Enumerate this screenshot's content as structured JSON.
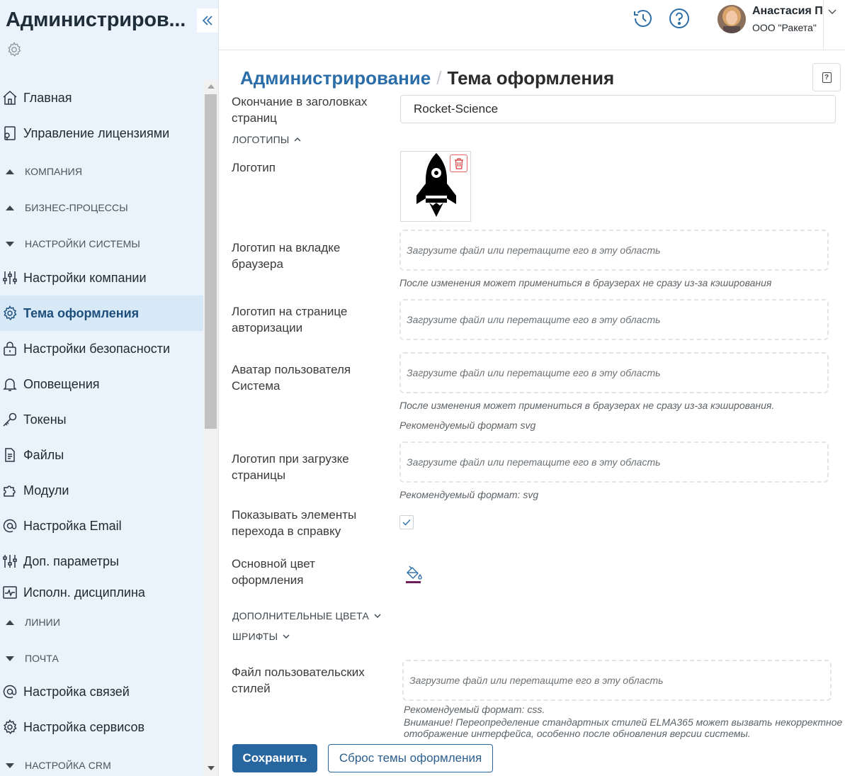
{
  "app": {
    "title": "Администриров...",
    "collapse_icon": "double-chevron-left-icon",
    "settings_icon": "gear-icon"
  },
  "sidebar": {
    "items": [
      {
        "type": "item",
        "label": "Главная",
        "icon": "home-icon"
      },
      {
        "type": "item",
        "label": "Управление лицензиями",
        "icon": "license-icon"
      },
      {
        "type": "section",
        "label": "КОМПАНИЯ",
        "state": "collapsed"
      },
      {
        "type": "section",
        "label": "БИЗНЕС-ПРОЦЕССЫ",
        "state": "collapsed"
      },
      {
        "type": "section",
        "label": "НАСТРОЙКИ СИСТЕМЫ",
        "state": "expanded"
      },
      {
        "type": "item",
        "label": "Настройки компании",
        "icon": "sliders-icon"
      },
      {
        "type": "item",
        "label": "Тема оформления",
        "icon": "gear-icon",
        "active": true
      },
      {
        "type": "item",
        "label": "Настройки безопасности",
        "icon": "lock-icon"
      },
      {
        "type": "item",
        "label": "Оповещения",
        "icon": "bell-icon"
      },
      {
        "type": "item",
        "label": "Токены",
        "icon": "key-icon"
      },
      {
        "type": "item",
        "label": "Файлы",
        "icon": "file-icon"
      },
      {
        "type": "item",
        "label": "Модули",
        "icon": "puzzle-icon"
      },
      {
        "type": "item",
        "label": "Настройка Email",
        "icon": "at-icon"
      },
      {
        "type": "item",
        "label": "Доп. параметры",
        "icon": "sliders-icon"
      },
      {
        "type": "item",
        "label": "Исполн. дисциплина",
        "icon": "pulse-icon"
      },
      {
        "type": "section",
        "label": "ЛИНИИ",
        "state": "collapsed"
      },
      {
        "type": "section",
        "label": "ПОЧТА",
        "state": "expanded"
      },
      {
        "type": "item",
        "label": "Настройка связей",
        "icon": "at-icon"
      },
      {
        "type": "item",
        "label": "Настройка сервисов",
        "icon": "gear-icon"
      },
      {
        "type": "section",
        "label": "НАСТРОЙКА CRM",
        "state": "expanded"
      }
    ]
  },
  "header": {
    "history_icon": "history-icon",
    "help_icon": "help-circle-icon",
    "user": {
      "name": "Анастасия П",
      "org": "ООО \"Ракета\"",
      "chevron_icon": "chevron-down-icon"
    }
  },
  "breadcrumb": {
    "root": "Администрирование",
    "separator": "/",
    "current": "Тема оформления"
  },
  "page_help": "?",
  "form": {
    "title_suffix": {
      "label": "Окончание в заголовках страниц",
      "value": "Rocket-Science"
    },
    "logos_section": "ЛОГОТИПЫ",
    "logo": {
      "label": "Логотип",
      "delete_icon": "trash-icon",
      "image_icon": "rocket-icon"
    },
    "favicon": {
      "label": "Логотип на вкладке браузера",
      "placeholder": "Загрузите файл или перетащите его в эту область",
      "hint": "После изменения может примениться в браузерах не сразу из-за кэширования"
    },
    "auth_logo": {
      "label": "Логотип на странице авторизации",
      "placeholder": "Загрузите файл или перетащите его в эту область"
    },
    "system_avatar": {
      "label": "Аватар пользователя Система",
      "placeholder": "Загрузите файл или перетащите его в эту область",
      "hint": "После изменения может примениться в браузерах не сразу из-за кэширования.",
      "hint2": "Рекомендуемый формат svg"
    },
    "loading_logo": {
      "label": "Логотип при загрузке страницы",
      "placeholder": "Загрузите файл или перетащите его в эту область",
      "hint": "Рекомендуемый формат: svg"
    },
    "show_help": {
      "label": "Показывать элементы перехода в справку",
      "checked": true
    },
    "main_color": {
      "label": "Основной цвет оформления",
      "color": "#6e1f57",
      "icon": "paint-bucket-icon"
    },
    "extra_colors_section": "ДОПОЛНИТЕЛЬНЫЕ ЦВЕТА",
    "fonts_section": "ШРИФТЫ",
    "custom_styles": {
      "label": "Файл пользовательских стилей",
      "placeholder": "Загрузите файл или перетащите его в эту область",
      "hint": "Рекомендуемый формат: css.",
      "warning_1": "Внимание! Переопределение стандартных стилей ELMA365 может вызвать некорректное",
      "warning_2": "отображение интерфейса, особенно после обновления версии системы."
    }
  },
  "actions": {
    "save": "Сохранить",
    "reset": "Сброс темы оформления"
  },
  "colors": {
    "accent": "#2866a0",
    "sidebar_bg": "#eaf3fb",
    "active_item_bg": "#d7e9f7",
    "danger": "#d63c3c"
  }
}
